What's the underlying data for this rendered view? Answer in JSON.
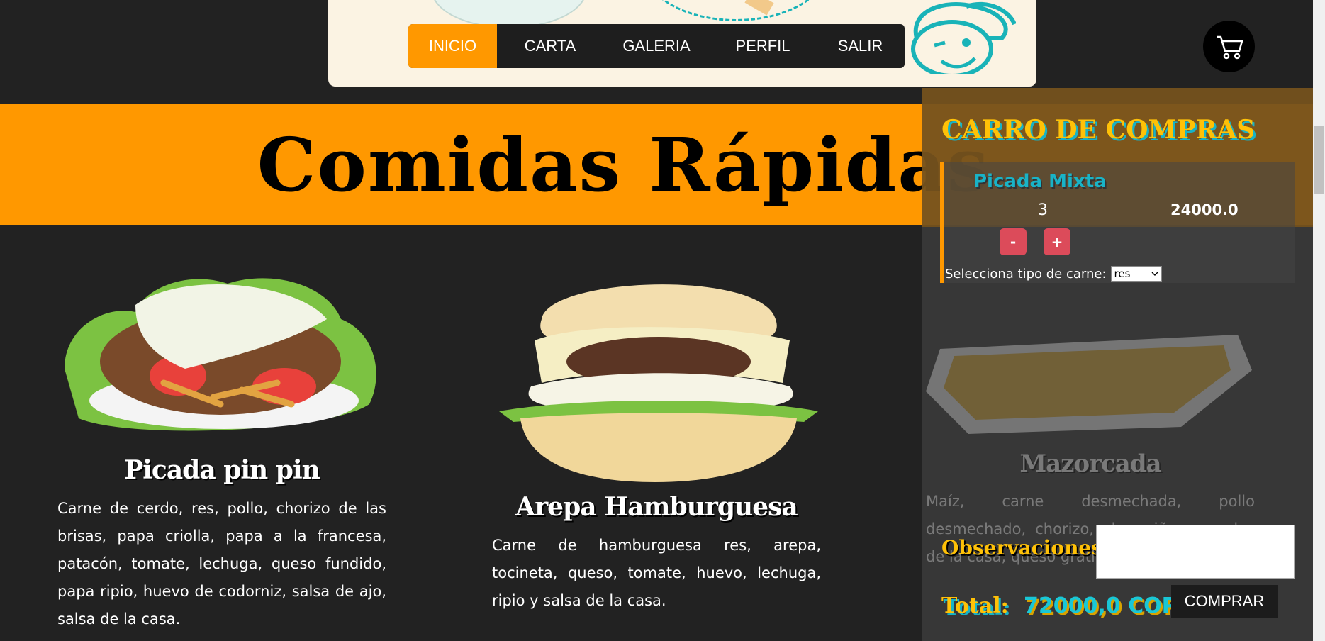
{
  "nav": {
    "items": [
      {
        "label": "INICIO",
        "active": true
      },
      {
        "label": "CARTA",
        "active": false
      },
      {
        "label": "GALERIA",
        "active": false
      },
      {
        "label": "PERFIL",
        "active": false
      },
      {
        "label": "SALIR",
        "active": false
      }
    ]
  },
  "cart_button": {
    "icon": "shopping-cart-icon"
  },
  "section": {
    "title": "Comidas Rápidas"
  },
  "products": [
    {
      "name": "Picada pin pin",
      "description": "Carne de cerdo, res, pollo, chorizo de las brisas, papa criolla, papa a la francesa, patacón, tomate, lechuga, queso fundido, papa ripio, huevo de codorniz, salsa de ajo, salsa de la casa."
    },
    {
      "name": "Arepa Hamburguesa",
      "description": "Carne de hamburguesa res, arepa, tocineta, queso, tomate, huevo, lechuga, ripio y salsa de la casa."
    },
    {
      "name": "Mazorcada",
      "description": "Maíz, carne desmechada, pollo desmechado, chorizo, champiñones, salsa de la casa, queso gratinado."
    }
  ],
  "cart": {
    "title": "CARRO DE COMPRAS",
    "item": {
      "name": "Picada Mixta",
      "quantity": "3",
      "price": "24000.0",
      "minus_label": "-",
      "plus_label": "+",
      "meat_label": "Selecciona tipo de carne:",
      "meat_selected": "res"
    },
    "observations_label": "Observaciones:",
    "total_label": "Total:",
    "total_value": "72000,0 COP",
    "buy_label": "COMPRAR"
  },
  "colors": {
    "accent": "#ff9800",
    "background": "#222222",
    "teal": "#19b3c7",
    "yellow": "#ffc107",
    "qty_button": "#dc4b5a"
  }
}
